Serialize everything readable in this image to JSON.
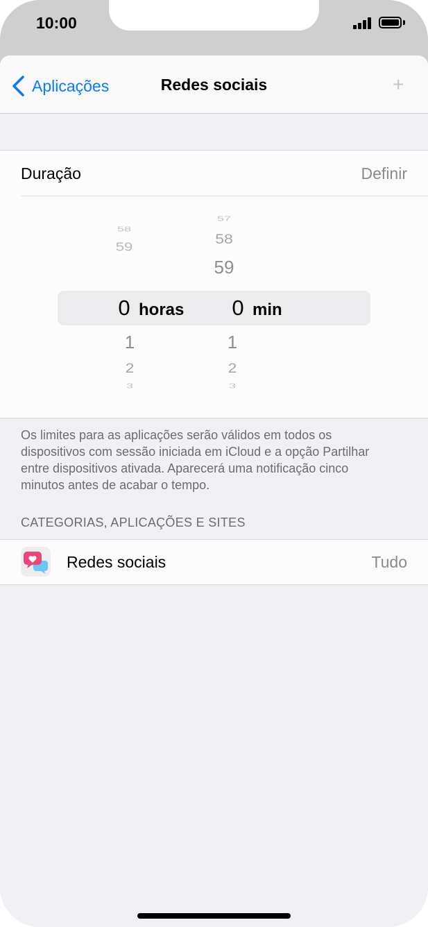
{
  "status_bar": {
    "time": "10:00"
  },
  "nav": {
    "back_label": "Aplicações",
    "title": "Redes sociais",
    "add_symbol": "+"
  },
  "duration": {
    "label": "Duração",
    "value": "Definir"
  },
  "picker": {
    "hours": {
      "above": [
        "58",
        "59"
      ],
      "selected": "0",
      "below": [
        "1",
        "2",
        "3"
      ],
      "unit": "horas"
    },
    "minutes": {
      "above": [
        "57",
        "58",
        "59"
      ],
      "selected": "0",
      "below": [
        "1",
        "2",
        "3"
      ],
      "unit": "min"
    }
  },
  "note": "Os limites para as aplicações serão válidos em todos os dispositivos com sessão iniciada em iCloud e a opção Partilhar entre dispositivos ativada. Aparecerá uma notificação cinco minutos antes de acabar o tempo.",
  "section_header": "CATEGORIAS, APLICAÇÕES E SITES",
  "category": {
    "label": "Redes sociais",
    "value": "Tudo"
  },
  "colors": {
    "accent": "#0a7aff",
    "heart": "#e8477c",
    "bubble": "#6ec6f5"
  }
}
